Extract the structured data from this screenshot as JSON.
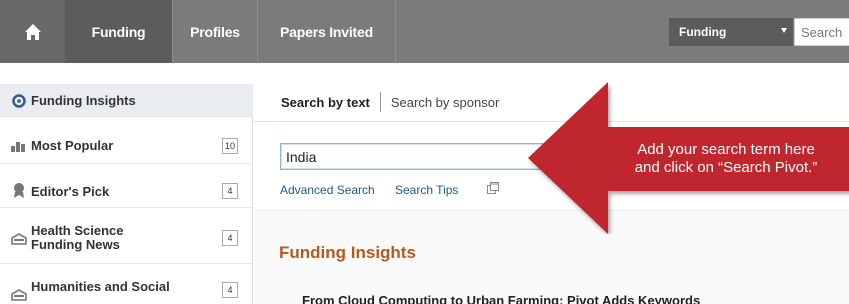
{
  "nav": {
    "tabs": [
      "Funding",
      "Profiles",
      "Papers Invited"
    ],
    "select_value": "Funding",
    "search_placeholder": "Search"
  },
  "sidebar": {
    "items": [
      {
        "label": "Funding Insights",
        "count": "",
        "icon": "insight-icon"
      },
      {
        "label": "Most Popular",
        "count": "10",
        "icon": "bar-chart-icon"
      },
      {
        "label": "Editor's Pick",
        "count": "4",
        "icon": "award-icon"
      },
      {
        "label_line1": "Health Science",
        "label_line2": "Funding News",
        "count": "4",
        "icon": "news-icon"
      },
      {
        "label_line1": "Humanities and Social",
        "count": "4",
        "icon": "news-icon"
      }
    ]
  },
  "main": {
    "tab_text": "Search by text",
    "tab_sponsor": "Search by sponsor",
    "search_value": "India",
    "advanced_search": "Advanced Search",
    "search_tips": "Search Tips",
    "section_title": "Funding Insights",
    "article_title": "From Cloud Computing to Urban Farming: Pivot Adds Keywords"
  },
  "callout": {
    "line1": "Add your search term here",
    "line2": "and click on “Search Pivot.”",
    "color": "#c0272d"
  }
}
